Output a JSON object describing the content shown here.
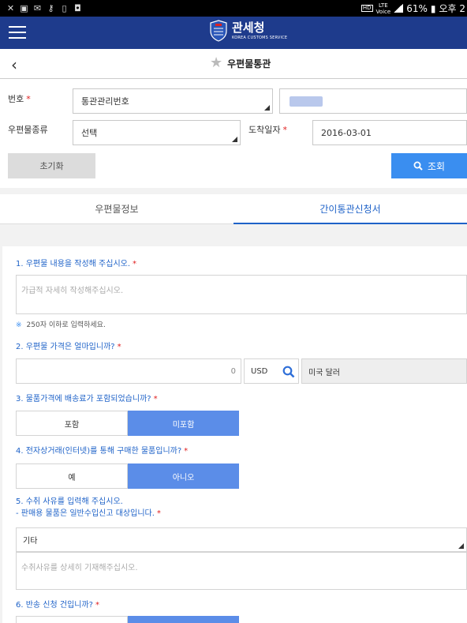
{
  "status_bar": {
    "badge": "HD",
    "network_top": "LTE",
    "network_bottom": "Voice",
    "battery": "61%",
    "time": "오후 2"
  },
  "app_bar": {
    "title": "관세청",
    "subtitle": "KOREA CUSTOMS SERVICE",
    "colors": {
      "primary": "#1e3b8c"
    }
  },
  "sub_header": {
    "title": "우편물통관"
  },
  "form": {
    "number_label": "번호",
    "number_type": "통관관리번호",
    "mail_type_label": "우편물종류",
    "mail_type_value": "선택",
    "arrival_label": "도착일자",
    "arrival_value": "2016-03-01",
    "reset_button": "초기화",
    "search_button": "조회"
  },
  "tabs": [
    {
      "label": "우편물정보",
      "active": false
    },
    {
      "label": "간이통관신청서",
      "active": true
    }
  ],
  "questions": {
    "q1": {
      "label": "1. 우편물 내용을 작성해 주십시오.",
      "placeholder": "가급적 자세히 작성해주십시오.",
      "note": "250자 이하로 입력하세요."
    },
    "q2": {
      "label": "2. 우편물 가격은 얼마입니까?",
      "amount": "0",
      "currency_code": "USD",
      "currency_name": "미국 달러"
    },
    "q3": {
      "label": "3. 물품가격에 배송료가 포함되었습니까?",
      "options": [
        "포함",
        "미포함"
      ],
      "selected": "미포함"
    },
    "q4": {
      "label": "4. 전자상거래(인터넷)를 통해 구매한 물품입니까?",
      "options": [
        "예",
        "아니오"
      ],
      "selected": "아니오"
    },
    "q5": {
      "label_line1": "5. 수취 사유를 입력해 주십시오.",
      "label_line2": "- 판매용 물품은 일반수입신고 대상입니다.",
      "reason_value": "기타",
      "placeholder": "수취사유를 상세히 기재해주십시오."
    },
    "q6": {
      "label": "6. 반송 신청 건입니까?"
    }
  }
}
